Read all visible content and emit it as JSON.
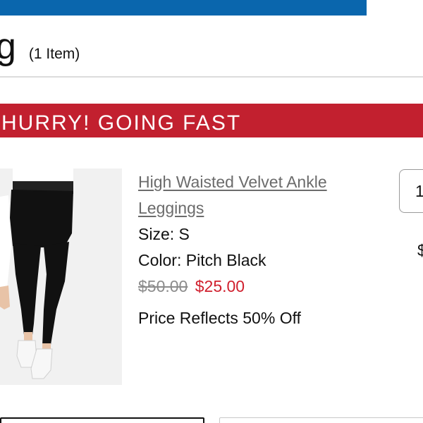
{
  "header": {
    "title_fragment": "g",
    "item_count": "(1 Item)"
  },
  "banner": {
    "text": "HURRY! GOING FAST"
  },
  "product": {
    "name": "High Waisted Velvet Ankle Leggings",
    "size": "Size: S",
    "color": "Color: Pitch Black",
    "original_price": "$50.00",
    "sale_price": "$25.00",
    "discount_note": "Price Reflects 50% Off",
    "quantity": "1",
    "line_total_partial": "$"
  },
  "colors": {
    "brand_blue": "#0a66ad",
    "banner_red": "#c2202f",
    "sale_red": "#d0202e"
  }
}
